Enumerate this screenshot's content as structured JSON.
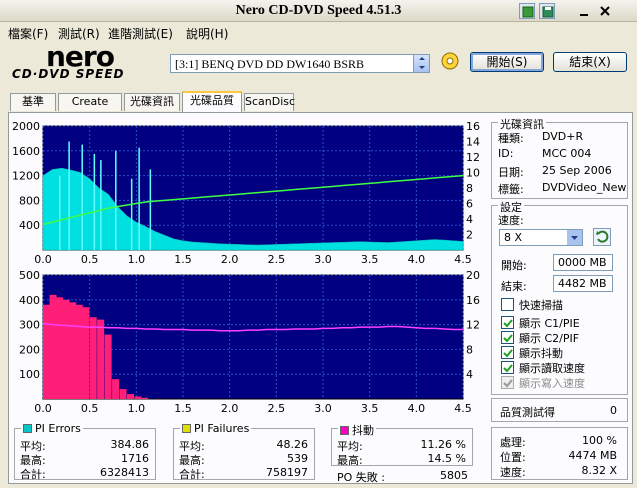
{
  "window": {
    "title": "Nero CD-DVD Speed 4.51.3"
  },
  "menu": [
    "檔案(F)",
    "測試(R)",
    "進階測試(E)",
    "說明(H)"
  ],
  "logo": {
    "line1": "nero",
    "line2": "CD·DVD SPEED"
  },
  "drive": {
    "selected": "[3:1]   BENQ DVD DD DW1640 BSRB"
  },
  "buttons": {
    "start": "開始(S)",
    "exit": "結束(X)"
  },
  "tabs": [
    "基準",
    "Create Disc",
    "光碟資訊",
    "光碟品質",
    "ScanDisc"
  ],
  "disc_info": {
    "legend": "光碟資訊",
    "rows": [
      {
        "label": "種類:",
        "value": "DVD+R"
      },
      {
        "label": "ID:",
        "value": "MCC 004"
      },
      {
        "label": "日期:",
        "value": "25 Sep 2006"
      },
      {
        "label": "標籤:",
        "value": "DVDVideo_New"
      }
    ]
  },
  "settings": {
    "legend": "設定",
    "speed_label": "速度:",
    "speed_value": "8 X",
    "start_label": "開始:",
    "start_value": "0000 MB",
    "end_label": "結束:",
    "end_value": "4482 MB",
    "checks": [
      {
        "label": "快速掃描",
        "checked": false,
        "disabled": false
      },
      {
        "label": "顯示 C1/PIE",
        "checked": true,
        "disabled": false
      },
      {
        "label": "顯示 C2/PIF",
        "checked": true,
        "disabled": false
      },
      {
        "label": "顯示抖動",
        "checked": true,
        "disabled": false
      },
      {
        "label": "顯示讀取速度",
        "checked": true,
        "disabled": false
      },
      {
        "label": "顯示寫入速度",
        "checked": true,
        "disabled": true
      }
    ]
  },
  "quality": {
    "label": "品質測試得",
    "value": "0"
  },
  "status": {
    "rows": [
      {
        "label": "處理:",
        "value": "100 %"
      },
      {
        "label": "位置:",
        "value": "4474 MB"
      },
      {
        "label": "速度:",
        "value": "8.32 X"
      }
    ]
  },
  "pi_errors": {
    "legend": "PI Errors",
    "color": "#00c8c8",
    "rows": [
      {
        "label": "平均:",
        "value": "384.86"
      },
      {
        "label": "最高:",
        "value": "1716"
      },
      {
        "label": "合計:",
        "value": "6328413"
      }
    ]
  },
  "pi_failures": {
    "legend": "PI Failures",
    "color": "#e0e000",
    "rows": [
      {
        "label": "平均:",
        "value": "48.26"
      },
      {
        "label": "最高:",
        "value": "539"
      },
      {
        "label": "合計:",
        "value": "758197"
      }
    ]
  },
  "jitter": {
    "legend": "抖動",
    "color": "#ff00c0",
    "rows": [
      {
        "label": "平均:",
        "value": "11.26 %"
      },
      {
        "label": "最高:",
        "value": "14.5 %"
      }
    ],
    "po_label": "PO 失敗 :",
    "po_value": "5805"
  },
  "chart_data": [
    {
      "type": "area",
      "series": [
        {
          "values": [
            1200,
            1300,
            1320,
            1290,
            1250,
            1150,
            1000,
            900,
            700,
            550,
            450,
            380,
            300,
            240,
            180,
            150,
            130,
            120,
            110,
            100,
            95,
            90,
            85,
            80,
            85,
            90,
            95,
            100,
            105,
            110,
            115,
            120,
            125,
            130,
            135,
            130,
            125,
            120,
            130,
            140,
            150,
            160,
            170,
            160,
            150,
            140
          ]
        },
        {
          "values": [
            3.3,
            3.6,
            3.9,
            4.2,
            4.5,
            4.8,
            5.1,
            5.4,
            5.6,
            5.8,
            6.0,
            6.2,
            6.3,
            6.4,
            6.5,
            6.6,
            6.7,
            6.8,
            6.9,
            7.0,
            7.1,
            7.2,
            7.3,
            7.4,
            7.5,
            7.6,
            7.7,
            7.8,
            7.9,
            8.0,
            8.1,
            8.2,
            8.3,
            8.4,
            8.5,
            8.6,
            8.7,
            8.8,
            8.9,
            9.0,
            9.1,
            9.2,
            9.3,
            9.4,
            9.5,
            9.6
          ]
        }
      ],
      "x": [
        0.0,
        0.1,
        0.2,
        0.3,
        0.4,
        0.5,
        0.6,
        0.7,
        0.8,
        0.9,
        1.0,
        1.1,
        1.2,
        1.3,
        1.4,
        1.5,
        1.6,
        1.7,
        1.8,
        1.9,
        2.0,
        2.1,
        2.2,
        2.3,
        2.4,
        2.5,
        2.6,
        2.7,
        2.8,
        2.9,
        3.0,
        3.1,
        3.2,
        3.3,
        3.4,
        3.5,
        3.6,
        3.7,
        3.8,
        3.9,
        4.0,
        4.1,
        4.2,
        4.3,
        4.4,
        4.5
      ],
      "spikes": [
        {
          "x": 0.28,
          "y": 1750
        },
        {
          "x": 0.42,
          "y": 1700
        },
        {
          "x": 0.55,
          "y": 1550
        },
        {
          "x": 0.62,
          "y": 1450
        },
        {
          "x": 0.78,
          "y": 1600
        },
        {
          "x": 0.95,
          "y": 1150
        },
        {
          "x": 1.03,
          "y": 1650
        },
        {
          "x": 1.15,
          "y": 1300
        },
        {
          "x": 0.18,
          "y": 1200
        }
      ],
      "xlim": [
        0,
        4.5
      ],
      "ylim_left": [
        0,
        2000
      ],
      "ylim_right": [
        0,
        16
      ],
      "xticks": [
        "0.0",
        "0.5",
        "1.0",
        "1.5",
        "2.0",
        "2.5",
        "3.0",
        "3.5",
        "4.0",
        "4.5"
      ],
      "yticks_left": [
        "2000",
        "1600",
        "1200",
        "800",
        "400"
      ],
      "yticks_right": [
        "16",
        "14",
        "12",
        "10",
        "8",
        "6",
        "4",
        "2"
      ]
    },
    {
      "type": "bar",
      "series": [
        {
          "values": [
            380,
            420,
            410,
            400,
            390,
            380,
            370,
            330,
            320,
            260,
            80,
            40,
            20,
            10,
            5,
            0
          ]
        },
        {
          "values": [
            12.2,
            12.0,
            11.9,
            11.8,
            11.7,
            11.6,
            11.6,
            11.5,
            11.5,
            11.4,
            11.4,
            11.3,
            11.3,
            11.2,
            11.2,
            11.2,
            11.1,
            11.1,
            11.1,
            11.0,
            11.0,
            11.0,
            11.1,
            11.1,
            11.2,
            11.2,
            11.2,
            11.3,
            11.3,
            11.3,
            11.4,
            11.4,
            11.5,
            11.5,
            11.6,
            11.6,
            11.6,
            11.7,
            11.7,
            11.6,
            11.5,
            11.4,
            11.4,
            11.3,
            11.2,
            11.2
          ]
        }
      ],
      "x_pif": [
        0.0,
        0.07,
        0.14,
        0.21,
        0.28,
        0.35,
        0.42,
        0.5,
        0.58,
        0.66,
        0.74,
        0.82,
        0.9,
        0.98,
        1.05,
        1.12
      ],
      "x_jitter": [
        0.0,
        0.1,
        0.2,
        0.3,
        0.4,
        0.5,
        0.6,
        0.7,
        0.8,
        0.9,
        1.0,
        1.1,
        1.2,
        1.3,
        1.4,
        1.5,
        1.6,
        1.7,
        1.8,
        1.9,
        2.0,
        2.1,
        2.2,
        2.3,
        2.4,
        2.5,
        2.6,
        2.7,
        2.8,
        2.9,
        3.0,
        3.1,
        3.2,
        3.3,
        3.4,
        3.5,
        3.6,
        3.7,
        3.8,
        3.9,
        4.0,
        4.1,
        4.2,
        4.3,
        4.4,
        4.5
      ],
      "xlim": [
        0,
        4.5
      ],
      "ylim_left": [
        0,
        500
      ],
      "ylim_right": [
        0,
        20
      ],
      "xticks": [
        "0.0",
        "0.5",
        "1.0",
        "1.5",
        "2.0",
        "2.5",
        "3.0",
        "3.5",
        "4.0",
        "4.5"
      ],
      "yticks_left": [
        "500",
        "400",
        "300",
        "200",
        "100"
      ],
      "yticks_right": [
        "20",
        "16",
        "12",
        "8",
        "4"
      ]
    }
  ]
}
